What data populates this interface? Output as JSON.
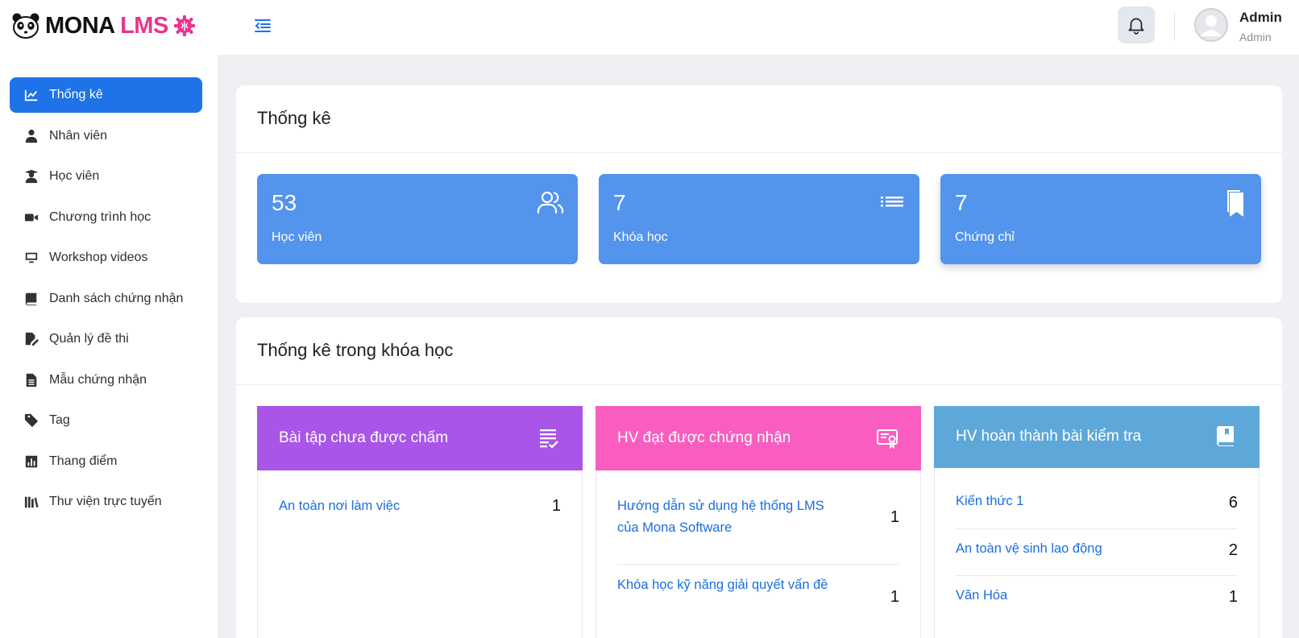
{
  "brand": {
    "name_part1": "MONA",
    "name_part2": "LMS",
    "accent": "#e8358f"
  },
  "sidebar": {
    "items": [
      {
        "label": "Thống kê",
        "icon": "chart-line-icon",
        "active": true
      },
      {
        "label": "Nhân viên",
        "icon": "user-tie-icon"
      },
      {
        "label": "Học viên",
        "icon": "user-graduate-icon"
      },
      {
        "label": "Chương trình học",
        "icon": "video-camera-icon"
      },
      {
        "label": "Workshop videos",
        "icon": "monitor-icon"
      },
      {
        "label": "Danh sách chứng nhận",
        "icon": "book-icon"
      },
      {
        "label": "Quản lý đề thi",
        "icon": "file-signature-icon"
      },
      {
        "label": "Mẫu chứng nhận",
        "icon": "file-lines-icon"
      },
      {
        "label": "Tag",
        "icon": "tag-icon"
      },
      {
        "label": "Thang điểm",
        "icon": "bar-chart-icon"
      },
      {
        "label": "Thư viện trực tuyến",
        "icon": "library-icon"
      }
    ]
  },
  "header": {
    "user_name": "Admin",
    "user_role": "Admin"
  },
  "stats_card": {
    "title": "Thống kê",
    "stats": [
      {
        "value": "53",
        "label": "Học viên",
        "icon": "users-icon"
      },
      {
        "value": "7",
        "label": "Khóa học",
        "icon": "list-icon"
      },
      {
        "value": "7",
        "label": "Chứng chỉ",
        "icon": "bookmark-icon"
      }
    ],
    "stat_color": "#5394ec"
  },
  "course_card": {
    "title": "Thống kê trong khóa học",
    "panels": [
      {
        "title": "Bài tập chưa được chấm",
        "color": "#a855e8",
        "icon": "checklist-icon",
        "rows": [
          {
            "label": "An toàn nơi làm việc",
            "count": "1"
          }
        ]
      },
      {
        "title": "HV đạt được chứng nhận",
        "color": "#f95dbf",
        "icon": "certificate-icon",
        "rows": [
          {
            "label": "Hướng dẫn sử dụng hệ thống LMS của Mona Software",
            "count": "1"
          },
          {
            "label": "Khóa học kỹ năng giải quyết vấn đề",
            "count": "1"
          }
        ]
      },
      {
        "title": "HV hoàn thành bài kiểm tra",
        "color": "#5ea8d9",
        "icon": "book-open-icon",
        "rows": [
          {
            "label": "Kiến thức 1",
            "count": "6"
          },
          {
            "label": "An toàn vệ sinh lao động",
            "count": "2"
          },
          {
            "label": "Văn Hóa",
            "count": "1"
          }
        ]
      }
    ]
  }
}
